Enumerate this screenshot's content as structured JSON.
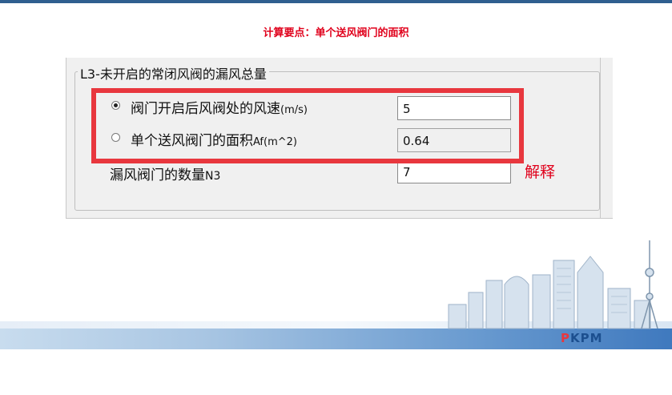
{
  "slide": {
    "heading": "计算要点：单个送风阀门的面积"
  },
  "group": {
    "title": "L3-未开启的常闭风阀的漏风总量"
  },
  "rows": [
    {
      "label_main": "阀门开启后风阀处的风速",
      "label_unit": "(m/s)",
      "value": "5",
      "selected": true
    },
    {
      "label_main": "单个送风阀门的面积",
      "label_unit": "Af(m^2)",
      "value": "0.64",
      "selected": false
    },
    {
      "label_main": "漏风阀门的数量",
      "label_unit": "N3",
      "value": "7"
    }
  ],
  "explain_link": "解释",
  "logo": {
    "p": "P",
    "k": "K",
    "pm": "PM"
  },
  "colors": {
    "accent_red": "#e8373e",
    "heading_red": "#e0001b",
    "band_blue": "#3f79be"
  }
}
